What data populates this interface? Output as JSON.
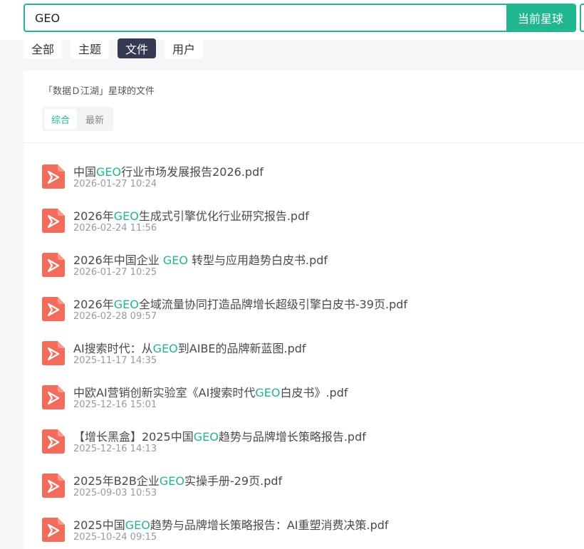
{
  "search": {
    "value": "GEO",
    "button_label": "当前星球"
  },
  "tabs": [
    {
      "label": "全部",
      "active": false
    },
    {
      "label": "主题",
      "active": false
    },
    {
      "label": "文件",
      "active": true
    },
    {
      "label": "用户",
      "active": false
    }
  ],
  "panel": {
    "title": "「数据Ｄ江湖」星球的文件",
    "sort_options": [
      {
        "label": "综合",
        "active": true
      },
      {
        "label": "最新",
        "active": false
      }
    ]
  },
  "files": [
    {
      "name_before": "中国",
      "name_highlight": "GEO",
      "name_after": "行业市场发展报告2026.pdf",
      "date": "2026-01-27 10:24"
    },
    {
      "name_before": "2026年",
      "name_highlight": "GEO",
      "name_after": "生成式引擎优化行业研究报告.pdf",
      "date": "2026-02-24 11:56"
    },
    {
      "name_before": "2026年中国企业 ",
      "name_highlight": "GEO",
      "name_after": " 转型与应用趋势白皮书.pdf",
      "date": "2026-01-27 10:25"
    },
    {
      "name_before": "2026年",
      "name_highlight": "GEO",
      "name_after": "全域流量协同打造品牌增长超级引擎白皮书-39页.pdf",
      "date": "2026-02-28 09:57"
    },
    {
      "name_before": "AI搜索时代：从",
      "name_highlight": "GEO",
      "name_after": "到AIBE的品牌新蓝图.pdf",
      "date": "2025-11-17 14:35"
    },
    {
      "name_before": "中欧AI营销创新实验室《AI搜索时代",
      "name_highlight": "GEO",
      "name_after": "白皮书》.pdf",
      "date": "2025-12-16 15:01"
    },
    {
      "name_before": "【增长黑盒】2025中国",
      "name_highlight": "GEO",
      "name_after": "趋势与品牌增长策略报告.pdf",
      "date": "2025-12-16 14:13"
    },
    {
      "name_before": "2025年B2B企业",
      "name_highlight": "GEO",
      "name_after": "实操手册-29页.pdf",
      "date": "2025-09-03 10:53"
    },
    {
      "name_before": "2025中国",
      "name_highlight": "GEO",
      "name_after": "趋势与品牌增长策略报告：AI重塑消费决策.pdf",
      "date": "2025-10-24 09:15"
    }
  ],
  "colors": {
    "accent": "#20b690",
    "tab_active_bg": "#353a52",
    "pdf_icon": "#f26b5b"
  },
  "icons": {
    "file": "pdf-file-icon"
  }
}
